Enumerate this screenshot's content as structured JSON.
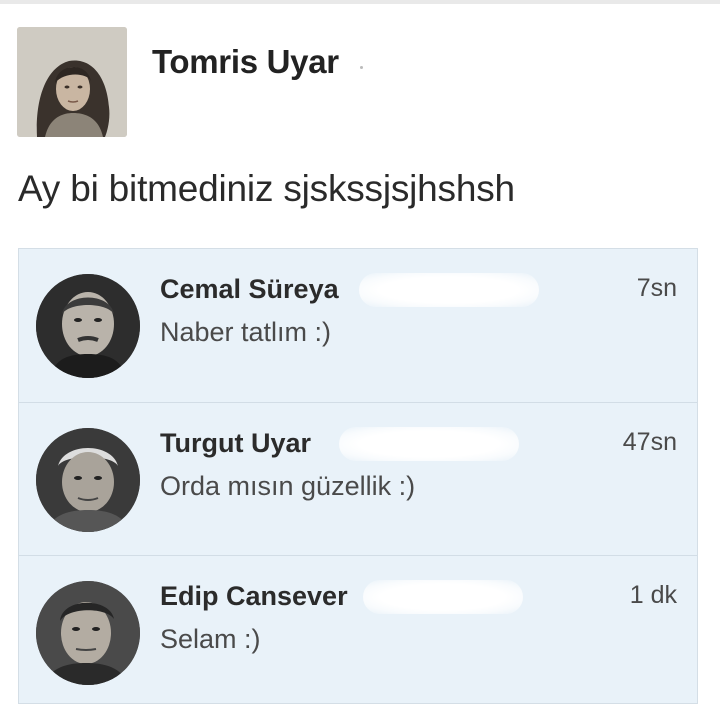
{
  "post": {
    "author": "Tomris Uyar",
    "text": "Ay bi bitmediniz sjskssjsjhshsh"
  },
  "chats": [
    {
      "name": "Cemal Süreya",
      "message": "Naber tatlım :)",
      "time": "7sn"
    },
    {
      "name": "Turgut Uyar",
      "message": "Orda mısın güzellik :)",
      "time": "47sn"
    },
    {
      "name": "Edip Cansever",
      "message": "Selam :)",
      "time": "1 dk"
    }
  ],
  "colors": {
    "list_background": "#e9f2f9",
    "divider": "#d2dde6",
    "text": "#2b2b2b"
  }
}
